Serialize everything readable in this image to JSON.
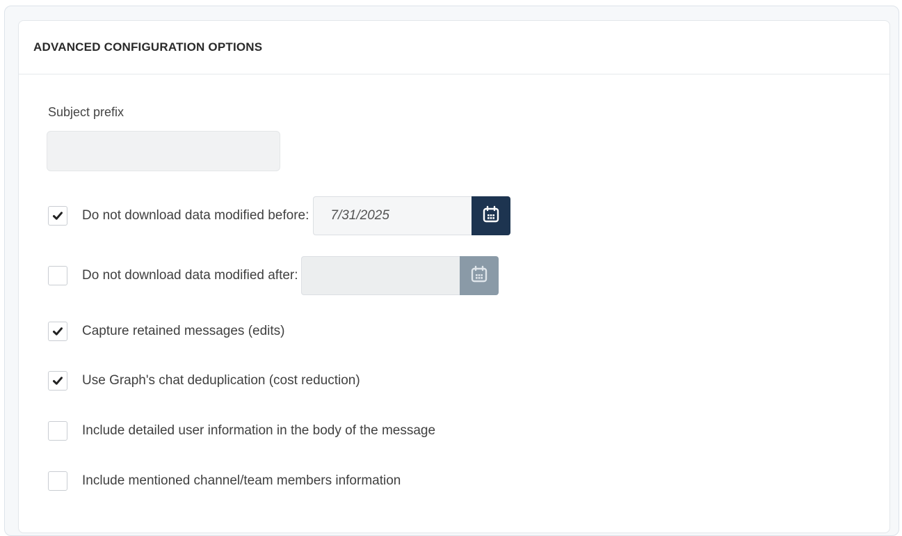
{
  "panel": {
    "title": "ADVANCED CONFIGURATION OPTIONS"
  },
  "subject_prefix": {
    "label": "Subject prefix",
    "value": "",
    "placeholder": ""
  },
  "options": {
    "before": {
      "label": "Do not download data modified before:",
      "checked": true,
      "date_value": "7/31/2025",
      "calendar_icon": "calendar-icon",
      "enabled": true
    },
    "after": {
      "label": "Do not download data modified after:",
      "checked": false,
      "date_value": "",
      "calendar_icon": "calendar-icon",
      "enabled": false
    },
    "capture_retained": {
      "label": "Capture retained messages (edits)",
      "checked": true
    },
    "graph_dedup": {
      "label": "Use Graph's chat deduplication (cost reduction)",
      "checked": true
    },
    "detailed_user_info": {
      "label": "Include detailed user information in the body of the message",
      "checked": false
    },
    "mentioned_members": {
      "label": "Include mentioned channel/team members information",
      "checked": false
    }
  },
  "colors": {
    "calendar_active": "#1d3450",
    "calendar_inactive": "#8a9aa7",
    "check_mark": "#222222"
  }
}
